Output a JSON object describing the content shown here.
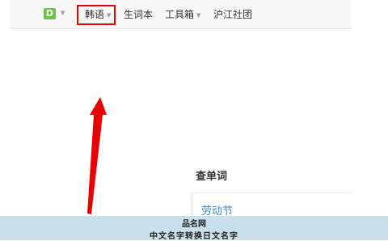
{
  "header": {
    "logo_letter": "D",
    "nav": [
      {
        "label": "韩语",
        "has_dropdown": true
      },
      {
        "label": "生词本",
        "has_dropdown": false
      },
      {
        "label": "工具箱",
        "has_dropdown": true
      },
      {
        "label": "沪江社团",
        "has_dropdown": false
      }
    ]
  },
  "lookup": {
    "title": "查单词",
    "word": "劳动节"
  },
  "watermark": {
    "title": "品名网",
    "subtitle": "中文名字转换日文名字"
  },
  "colors": {
    "highlight": "#e60000",
    "arrow": "#e60000",
    "logo": "#6cc24a",
    "link": "#3c8cc8",
    "watermark_bg": "#c9e0ea"
  },
  "icons": {
    "logo": "d-logo-icon",
    "dropdown": "chevron-down-icon"
  }
}
